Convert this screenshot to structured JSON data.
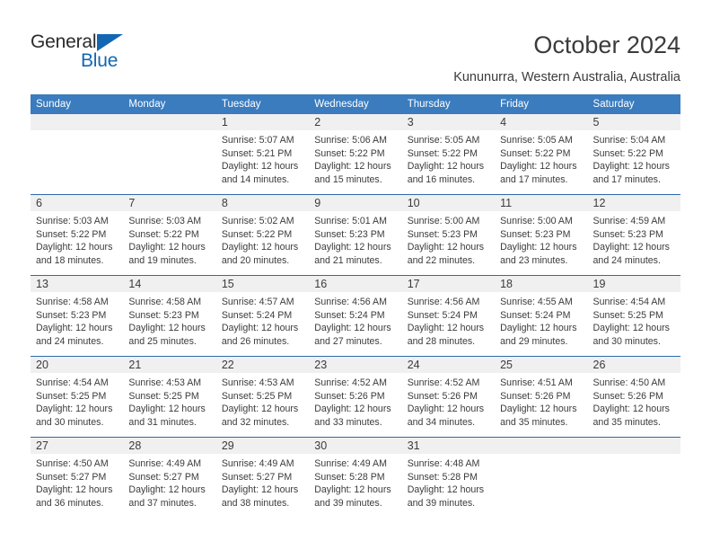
{
  "brand": {
    "name_part1": "General",
    "name_part2": "Blue",
    "accent_color": "#1267b2"
  },
  "header": {
    "title": "October 2024",
    "subtitle": "Kununurra, Western Australia, Australia"
  },
  "calendar": {
    "header_bg": "#3a7cbe",
    "daynum_band_bg": "#f0f0f0",
    "row_rule_color": "#2f6aa8",
    "weekday_headers": [
      "Sunday",
      "Monday",
      "Tuesday",
      "Wednesday",
      "Thursday",
      "Friday",
      "Saturday"
    ],
    "weeks": [
      [
        {
          "day": "",
          "sunrise": "",
          "sunset": "",
          "daylight": ""
        },
        {
          "day": "",
          "sunrise": "",
          "sunset": "",
          "daylight": ""
        },
        {
          "day": "1",
          "sunrise": "Sunrise: 5:07 AM",
          "sunset": "Sunset: 5:21 PM",
          "daylight": "Daylight: 12 hours and 14 minutes."
        },
        {
          "day": "2",
          "sunrise": "Sunrise: 5:06 AM",
          "sunset": "Sunset: 5:22 PM",
          "daylight": "Daylight: 12 hours and 15 minutes."
        },
        {
          "day": "3",
          "sunrise": "Sunrise: 5:05 AM",
          "sunset": "Sunset: 5:22 PM",
          "daylight": "Daylight: 12 hours and 16 minutes."
        },
        {
          "day": "4",
          "sunrise": "Sunrise: 5:05 AM",
          "sunset": "Sunset: 5:22 PM",
          "daylight": "Daylight: 12 hours and 17 minutes."
        },
        {
          "day": "5",
          "sunrise": "Sunrise: 5:04 AM",
          "sunset": "Sunset: 5:22 PM",
          "daylight": "Daylight: 12 hours and 17 minutes."
        }
      ],
      [
        {
          "day": "6",
          "sunrise": "Sunrise: 5:03 AM",
          "sunset": "Sunset: 5:22 PM",
          "daylight": "Daylight: 12 hours and 18 minutes."
        },
        {
          "day": "7",
          "sunrise": "Sunrise: 5:03 AM",
          "sunset": "Sunset: 5:22 PM",
          "daylight": "Daylight: 12 hours and 19 minutes."
        },
        {
          "day": "8",
          "sunrise": "Sunrise: 5:02 AM",
          "sunset": "Sunset: 5:22 PM",
          "daylight": "Daylight: 12 hours and 20 minutes."
        },
        {
          "day": "9",
          "sunrise": "Sunrise: 5:01 AM",
          "sunset": "Sunset: 5:23 PM",
          "daylight": "Daylight: 12 hours and 21 minutes."
        },
        {
          "day": "10",
          "sunrise": "Sunrise: 5:00 AM",
          "sunset": "Sunset: 5:23 PM",
          "daylight": "Daylight: 12 hours and 22 minutes."
        },
        {
          "day": "11",
          "sunrise": "Sunrise: 5:00 AM",
          "sunset": "Sunset: 5:23 PM",
          "daylight": "Daylight: 12 hours and 23 minutes."
        },
        {
          "day": "12",
          "sunrise": "Sunrise: 4:59 AM",
          "sunset": "Sunset: 5:23 PM",
          "daylight": "Daylight: 12 hours and 24 minutes."
        }
      ],
      [
        {
          "day": "13",
          "sunrise": "Sunrise: 4:58 AM",
          "sunset": "Sunset: 5:23 PM",
          "daylight": "Daylight: 12 hours and 24 minutes."
        },
        {
          "day": "14",
          "sunrise": "Sunrise: 4:58 AM",
          "sunset": "Sunset: 5:23 PM",
          "daylight": "Daylight: 12 hours and 25 minutes."
        },
        {
          "day": "15",
          "sunrise": "Sunrise: 4:57 AM",
          "sunset": "Sunset: 5:24 PM",
          "daylight": "Daylight: 12 hours and 26 minutes."
        },
        {
          "day": "16",
          "sunrise": "Sunrise: 4:56 AM",
          "sunset": "Sunset: 5:24 PM",
          "daylight": "Daylight: 12 hours and 27 minutes."
        },
        {
          "day": "17",
          "sunrise": "Sunrise: 4:56 AM",
          "sunset": "Sunset: 5:24 PM",
          "daylight": "Daylight: 12 hours and 28 minutes."
        },
        {
          "day": "18",
          "sunrise": "Sunrise: 4:55 AM",
          "sunset": "Sunset: 5:24 PM",
          "daylight": "Daylight: 12 hours and 29 minutes."
        },
        {
          "day": "19",
          "sunrise": "Sunrise: 4:54 AM",
          "sunset": "Sunset: 5:25 PM",
          "daylight": "Daylight: 12 hours and 30 minutes."
        }
      ],
      [
        {
          "day": "20",
          "sunrise": "Sunrise: 4:54 AM",
          "sunset": "Sunset: 5:25 PM",
          "daylight": "Daylight: 12 hours and 30 minutes."
        },
        {
          "day": "21",
          "sunrise": "Sunrise: 4:53 AM",
          "sunset": "Sunset: 5:25 PM",
          "daylight": "Daylight: 12 hours and 31 minutes."
        },
        {
          "day": "22",
          "sunrise": "Sunrise: 4:53 AM",
          "sunset": "Sunset: 5:25 PM",
          "daylight": "Daylight: 12 hours and 32 minutes."
        },
        {
          "day": "23",
          "sunrise": "Sunrise: 4:52 AM",
          "sunset": "Sunset: 5:26 PM",
          "daylight": "Daylight: 12 hours and 33 minutes."
        },
        {
          "day": "24",
          "sunrise": "Sunrise: 4:52 AM",
          "sunset": "Sunset: 5:26 PM",
          "daylight": "Daylight: 12 hours and 34 minutes."
        },
        {
          "day": "25",
          "sunrise": "Sunrise: 4:51 AM",
          "sunset": "Sunset: 5:26 PM",
          "daylight": "Daylight: 12 hours and 35 minutes."
        },
        {
          "day": "26",
          "sunrise": "Sunrise: 4:50 AM",
          "sunset": "Sunset: 5:26 PM",
          "daylight": "Daylight: 12 hours and 35 minutes."
        }
      ],
      [
        {
          "day": "27",
          "sunrise": "Sunrise: 4:50 AM",
          "sunset": "Sunset: 5:27 PM",
          "daylight": "Daylight: 12 hours and 36 minutes."
        },
        {
          "day": "28",
          "sunrise": "Sunrise: 4:49 AM",
          "sunset": "Sunset: 5:27 PM",
          "daylight": "Daylight: 12 hours and 37 minutes."
        },
        {
          "day": "29",
          "sunrise": "Sunrise: 4:49 AM",
          "sunset": "Sunset: 5:27 PM",
          "daylight": "Daylight: 12 hours and 38 minutes."
        },
        {
          "day": "30",
          "sunrise": "Sunrise: 4:49 AM",
          "sunset": "Sunset: 5:28 PM",
          "daylight": "Daylight: 12 hours and 39 minutes."
        },
        {
          "day": "31",
          "sunrise": "Sunrise: 4:48 AM",
          "sunset": "Sunset: 5:28 PM",
          "daylight": "Daylight: 12 hours and 39 minutes."
        },
        {
          "day": "",
          "sunrise": "",
          "sunset": "",
          "daylight": ""
        },
        {
          "day": "",
          "sunrise": "",
          "sunset": "",
          "daylight": ""
        }
      ]
    ]
  }
}
